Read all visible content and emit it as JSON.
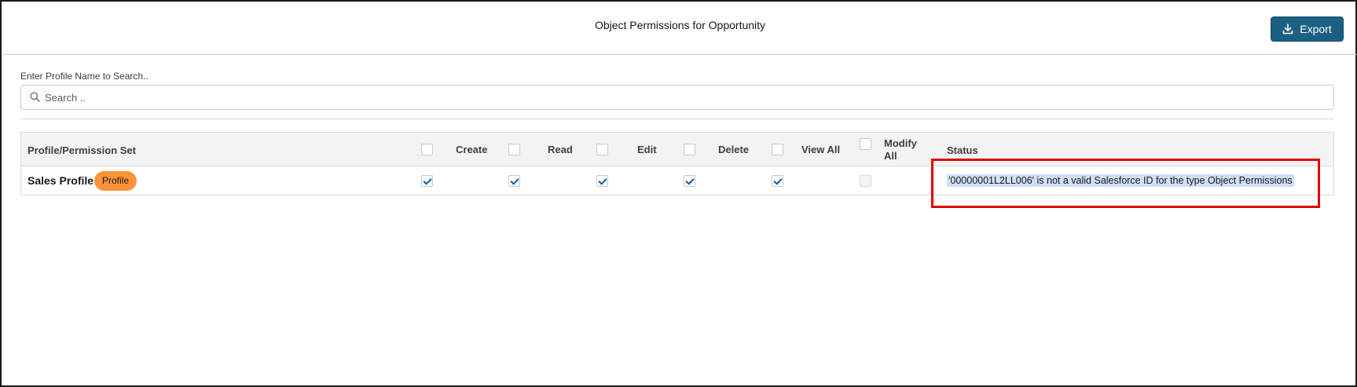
{
  "header": {
    "title": "Object Permissions for Opportunity",
    "export_label": "Export",
    "export_icon": "download-icon"
  },
  "search": {
    "label": "Enter Profile Name to Search..",
    "placeholder": "Search ..",
    "value": "",
    "icon": "search-icon"
  },
  "table": {
    "columns": [
      "Profile/Permission Set",
      "Create",
      "Read",
      "Edit",
      "Delete",
      "View All",
      "Modify",
      "All",
      "Status"
    ],
    "rows": [
      {
        "name": "Sales Profile",
        "badge": "Profile",
        "create": true,
        "read": true,
        "edit": true,
        "delete": true,
        "view_all": true,
        "modify_all": false,
        "status": "'00000001L2LL006' is not a valid Salesforce ID for the type Object Permissions"
      }
    ]
  },
  "colors": {
    "export_bg": "#1b5f82",
    "badge_bg": "#fe9339",
    "status_highlight": "#cfe0f5",
    "annotation_red": "#e00000"
  }
}
